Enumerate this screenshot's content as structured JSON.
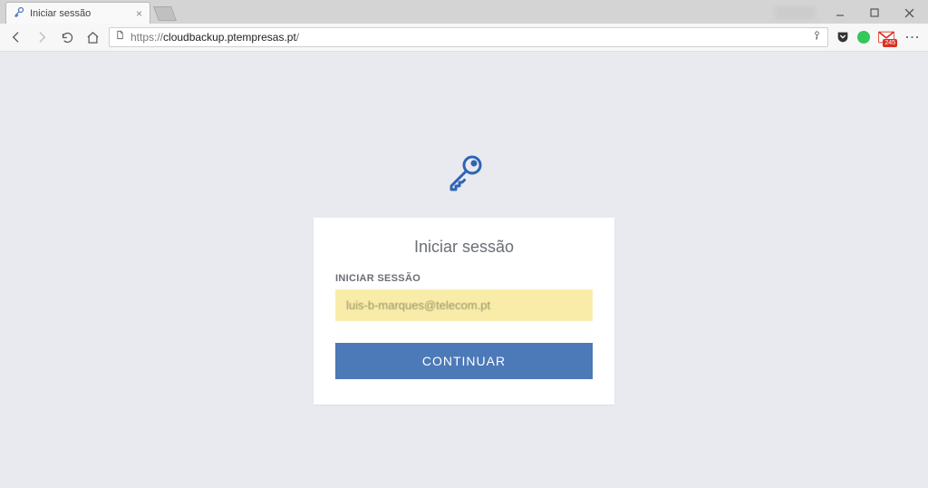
{
  "browser": {
    "tab_title": "Iniciar sessão",
    "url_protocol": "https://",
    "url_domain": "cloudbackup.ptempresas.pt",
    "url_path": "/",
    "mail_badge": "245"
  },
  "login": {
    "heading": "Iniciar sessão",
    "field_label": "INICIAR SESSÃO",
    "field_value": "luis-b-marques@telecom.pt",
    "continue_label": "CONTINUAR"
  }
}
